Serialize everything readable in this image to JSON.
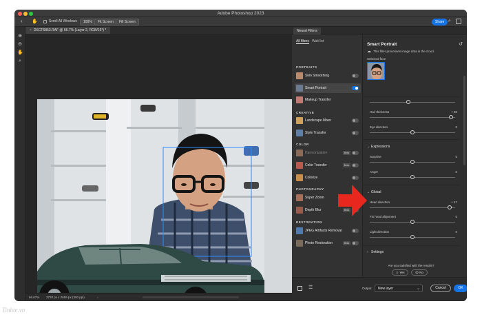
{
  "window": {
    "title": "Adobe Photoshop 2023"
  },
  "options_bar": {
    "scroll_all_windows": "Scroll All Windows",
    "zoom_100": "100%",
    "fit_screen": "Fit Screen",
    "fill_screen": "Fill Screen",
    "share": "Share"
  },
  "document": {
    "tab_title": "DSCF6853.RAF @ 66.7% (Layer 2, RGB/16*) *",
    "zoom": "66.67%",
    "dimensions": "3720 px x 2659 px (300 ppi)"
  },
  "neural_filters": {
    "panel_tab": "Neural Filters",
    "list_tabs": [
      "All filters",
      "Wait list"
    ],
    "categories": {
      "portraits": "PORTRAITS",
      "creative": "CREATIVE",
      "color": "COLOR",
      "photography": "PHOTOGRAPHY",
      "restoration": "RESTORATION"
    },
    "filters": {
      "skin_smoothing": "Skin Smoothing",
      "smart_portrait": "Smart Portrait",
      "makeup_transfer": "Makeup Transfer",
      "landscape_mixer": "Landscape Mixer",
      "style_transfer": "Style Transfer",
      "harmonization": "Harmonization",
      "color_transfer": "Color Transfer",
      "colorize": "Colorize",
      "super_zoom": "Super Zoom",
      "depth_blur": "Depth Blur",
      "jpeg_artifacts_removal": "JPEG Artifacts Removal",
      "photo_restoration": "Photo Restoration"
    },
    "beta_label": "Beta"
  },
  "settings": {
    "title": "Smart Portrait",
    "cloud_note": "This filter processes image data in the cloud.",
    "selected_face_label": "Selected face",
    "hair_thickness": {
      "label": "Hair thickness",
      "value": "+ 50"
    },
    "eye_direction": {
      "label": "Eye direction",
      "value": "0"
    },
    "expressions_section": "Expressions",
    "surprise": {
      "label": "Surprise",
      "value": "0"
    },
    "anger": {
      "label": "Anger",
      "value": "0"
    },
    "global_section": "Global",
    "head_direction": {
      "label": "Head direction",
      "value": "+ 47"
    },
    "fix_head_alignment": {
      "label": "Fix head alignment",
      "value": "0"
    },
    "light_direction": {
      "label": "Light direction",
      "value": "0"
    },
    "settings_section": "Settings",
    "satisfied_question": "Are you satisfied with the results?",
    "yes": "Yes",
    "no": "No"
  },
  "footer": {
    "output_label": "Output",
    "output_value": "New layer",
    "cancel": "Cancel",
    "ok": "OK"
  },
  "watermark": "Tinhte.vn",
  "colors": {
    "accent": "#1473e6",
    "annotation_arrow": "#e8281f"
  }
}
